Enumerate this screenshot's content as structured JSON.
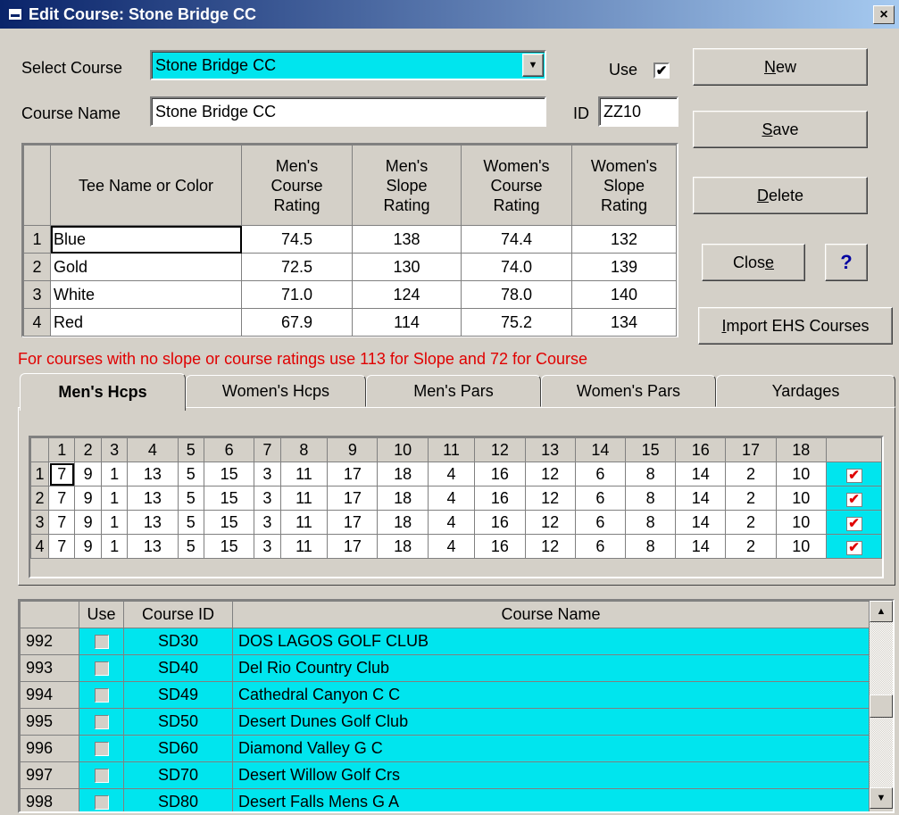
{
  "window": {
    "title": "Edit Course: Stone Bridge CC",
    "close_glyph": "×"
  },
  "select_course": {
    "label": "Select Course",
    "value": "Stone Bridge CC"
  },
  "use": {
    "label": "Use",
    "checked": true
  },
  "course_name": {
    "label": "Course Name",
    "value": "Stone Bridge CC"
  },
  "id_field": {
    "label": "ID",
    "value": "ZZ10"
  },
  "buttons": {
    "new": {
      "pre": "",
      "key": "N",
      "post": "ew"
    },
    "save": {
      "pre": "",
      "key": "S",
      "post": "ave"
    },
    "delete": {
      "pre": "",
      "key": "D",
      "post": "elete"
    },
    "close": {
      "pre": "Clos",
      "key": "e",
      "post": ""
    },
    "help": "?",
    "import": {
      "pre": "",
      "key": "I",
      "post": "mport EHS Courses"
    }
  },
  "tees": {
    "headers": [
      "Tee Name or Color",
      "Men's Course Rating",
      "Men's Slope Rating",
      "Women's Course Rating",
      "Women's Slope Rating"
    ],
    "header_lines": [
      [
        "Tee Name or Color"
      ],
      [
        "Men's",
        "Course",
        "Rating"
      ],
      [
        "Men's",
        "Slope",
        "Rating"
      ],
      [
        "Women's",
        "Course",
        "Rating"
      ],
      [
        "Women's",
        "Slope",
        "Rating"
      ]
    ],
    "rows": [
      {
        "n": "1",
        "name": "Blue",
        "mcr": "74.5",
        "msr": "138",
        "wcr": "74.4",
        "wsr": "132"
      },
      {
        "n": "2",
        "name": "Gold",
        "mcr": "72.5",
        "msr": "130",
        "wcr": "74.0",
        "wsr": "139"
      },
      {
        "n": "3",
        "name": "White",
        "mcr": "71.0",
        "msr": "124",
        "wcr": "78.0",
        "wsr": "140"
      },
      {
        "n": "4",
        "name": "Red",
        "mcr": "67.9",
        "msr": "114",
        "wcr": "75.2",
        "wsr": "134"
      }
    ]
  },
  "note": "For courses with no slope or course ratings use 113 for Slope and 72 for Course",
  "tabs": [
    "Men's Hcps",
    "Women's Hcps",
    "Men's Pars",
    "Women's Pars",
    "Yardages"
  ],
  "active_tab": 0,
  "hcps": {
    "columns": [
      "1",
      "2",
      "3",
      "4",
      "5",
      "6",
      "7",
      "8",
      "9",
      "10",
      "11",
      "12",
      "13",
      "14",
      "15",
      "16",
      "17",
      "18"
    ],
    "rows": [
      {
        "n": "1",
        "values": [
          "7",
          "9",
          "1",
          "13",
          "5",
          "15",
          "3",
          "11",
          "17",
          "18",
          "4",
          "16",
          "12",
          "6",
          "8",
          "14",
          "2",
          "10"
        ],
        "checked": true
      },
      {
        "n": "2",
        "values": [
          "7",
          "9",
          "1",
          "13",
          "5",
          "15",
          "3",
          "11",
          "17",
          "18",
          "4",
          "16",
          "12",
          "6",
          "8",
          "14",
          "2",
          "10"
        ],
        "checked": true
      },
      {
        "n": "3",
        "values": [
          "7",
          "9",
          "1",
          "13",
          "5",
          "15",
          "3",
          "11",
          "17",
          "18",
          "4",
          "16",
          "12",
          "6",
          "8",
          "14",
          "2",
          "10"
        ],
        "checked": true
      },
      {
        "n": "4",
        "values": [
          "7",
          "9",
          "1",
          "13",
          "5",
          "15",
          "3",
          "11",
          "17",
          "18",
          "4",
          "16",
          "12",
          "6",
          "8",
          "14",
          "2",
          "10"
        ],
        "checked": true
      }
    ],
    "check_glyph": "✔"
  },
  "course_list": {
    "headers": {
      "use": "Use",
      "id": "Course ID",
      "name": "Course Name"
    },
    "rows": [
      {
        "n": "992",
        "id": "SD30",
        "name": "DOS LAGOS GOLF CLUB"
      },
      {
        "n": "993",
        "id": "SD40",
        "name": "Del Rio Country Club"
      },
      {
        "n": "994",
        "id": "SD49",
        "name": "Cathedral Canyon C C"
      },
      {
        "n": "995",
        "id": "SD50",
        "name": "Desert Dunes Golf Club"
      },
      {
        "n": "996",
        "id": "SD60",
        "name": "Diamond Valley G C"
      },
      {
        "n": "997",
        "id": "SD70",
        "name": "Desert Willow Golf Crs"
      },
      {
        "n": "998",
        "id": "SD80",
        "name": "Desert Falls Mens G A"
      }
    ]
  },
  "colors": {
    "highlight": "#00e5ee",
    "title_bar": "#0a246a",
    "note": "#e00000"
  }
}
